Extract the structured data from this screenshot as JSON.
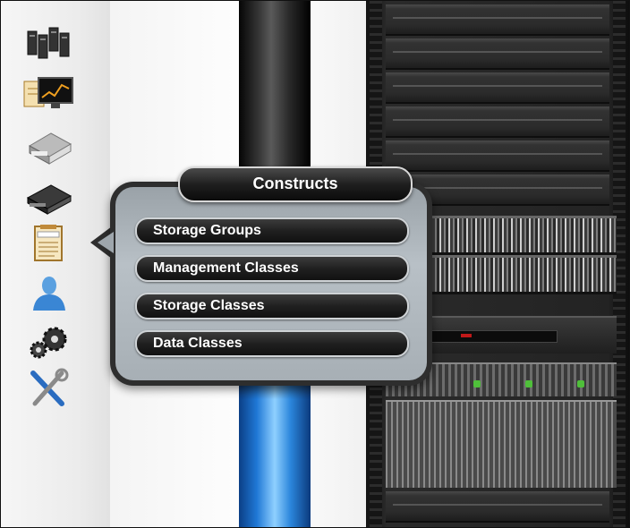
{
  "nav": {
    "icons": [
      {
        "name": "servers-icon"
      },
      {
        "name": "monitoring-icon"
      },
      {
        "name": "storage-system-icon"
      },
      {
        "name": "storage-device-icon"
      },
      {
        "name": "policies-icon",
        "label": "POLICIES"
      },
      {
        "name": "user-icon"
      },
      {
        "name": "settings-gears-icon"
      },
      {
        "name": "tools-icon"
      }
    ]
  },
  "popup": {
    "title": "Constructs",
    "items": [
      {
        "label": "Storage Groups"
      },
      {
        "label": "Management Classes"
      },
      {
        "label": "Storage Classes"
      },
      {
        "label": "Data Classes"
      }
    ]
  },
  "colors": {
    "accent_tube": "#1f78d6",
    "popup_body": "#a7afb5",
    "pill_dark": "#1f1f1f"
  }
}
